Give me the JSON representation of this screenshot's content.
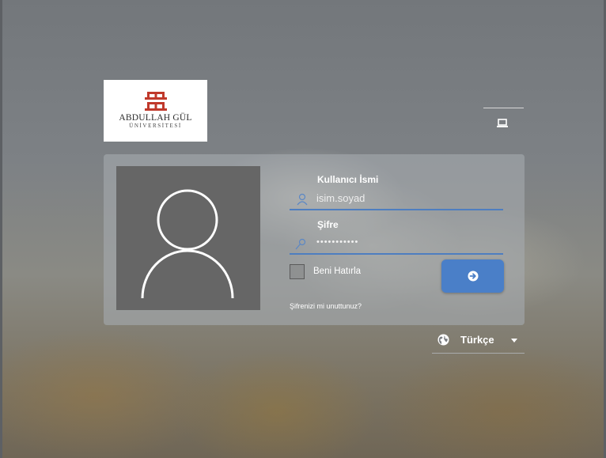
{
  "brand": {
    "line1": "ABDULLAH GÜL",
    "line2": "ÜNİVERSİTESİ",
    "logo_color": "#c0392b"
  },
  "device_icon": "laptop-icon",
  "login": {
    "username_label": "Kullanıcı İsmi",
    "username_placeholder": "isim.soyad",
    "password_label": "Şifre",
    "password_value": "•••••••••••",
    "remember_label": "Beni Hatırla",
    "submit_icon": "arrow-right-circle-icon",
    "forgot_link": "Şifrenizi mi unuttunuz?"
  },
  "language": {
    "selected": "Türkçe",
    "icon": "globe-icon"
  },
  "colors": {
    "accent": "#4a7fc8",
    "panel": "#a5aaae",
    "avatar_bg": "#666666"
  }
}
